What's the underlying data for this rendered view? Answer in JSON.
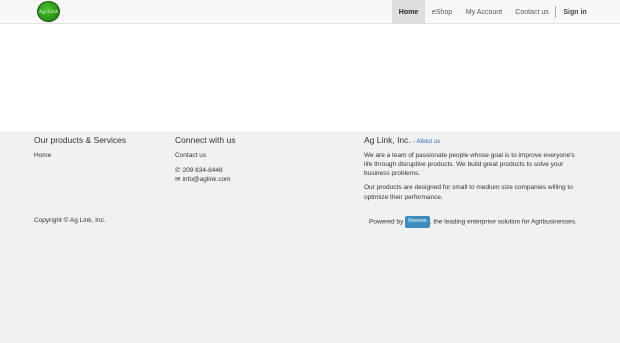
{
  "header": {
    "logo_text": "Ag Link",
    "nav": [
      {
        "label": "Home",
        "active": true
      },
      {
        "label": "eShop"
      },
      {
        "label": "My Account"
      },
      {
        "label": "Contact us"
      },
      {
        "label": "Sign in"
      }
    ]
  },
  "footer": {
    "products": {
      "heading": "Our products & Services",
      "links": [
        "Home"
      ]
    },
    "connect": {
      "heading": "Connect with us",
      "contact_link": "Contact us",
      "phone": "209 834-8448",
      "email": "info@aglink.com"
    },
    "about": {
      "heading": "Ag Link, Inc.",
      "about_link": "- About us",
      "para1_line1": "We are a team of passionate people whose goal is to improve everyone's",
      "para1_line2": "life through disruptive products. We build great products to solve your",
      "para1_line3": "business problems.",
      "para2_line1": "Our products are designed for small to medium size companies willing to",
      "para2_line2": "optimize their performance."
    },
    "copyright": "Copyright © Ag Link, Inc.",
    "powered_prefix": "Powered by",
    "powered_badge": "Reserve",
    "powered_suffix": ", the leading enterprise solution for Agribusinesses."
  },
  "colors": {
    "link": "#2a6fba",
    "badge": "#3c8dbc",
    "logo": "#2e9a1b"
  },
  "icons": [
    "phone-icon",
    "envelope-icon"
  ]
}
